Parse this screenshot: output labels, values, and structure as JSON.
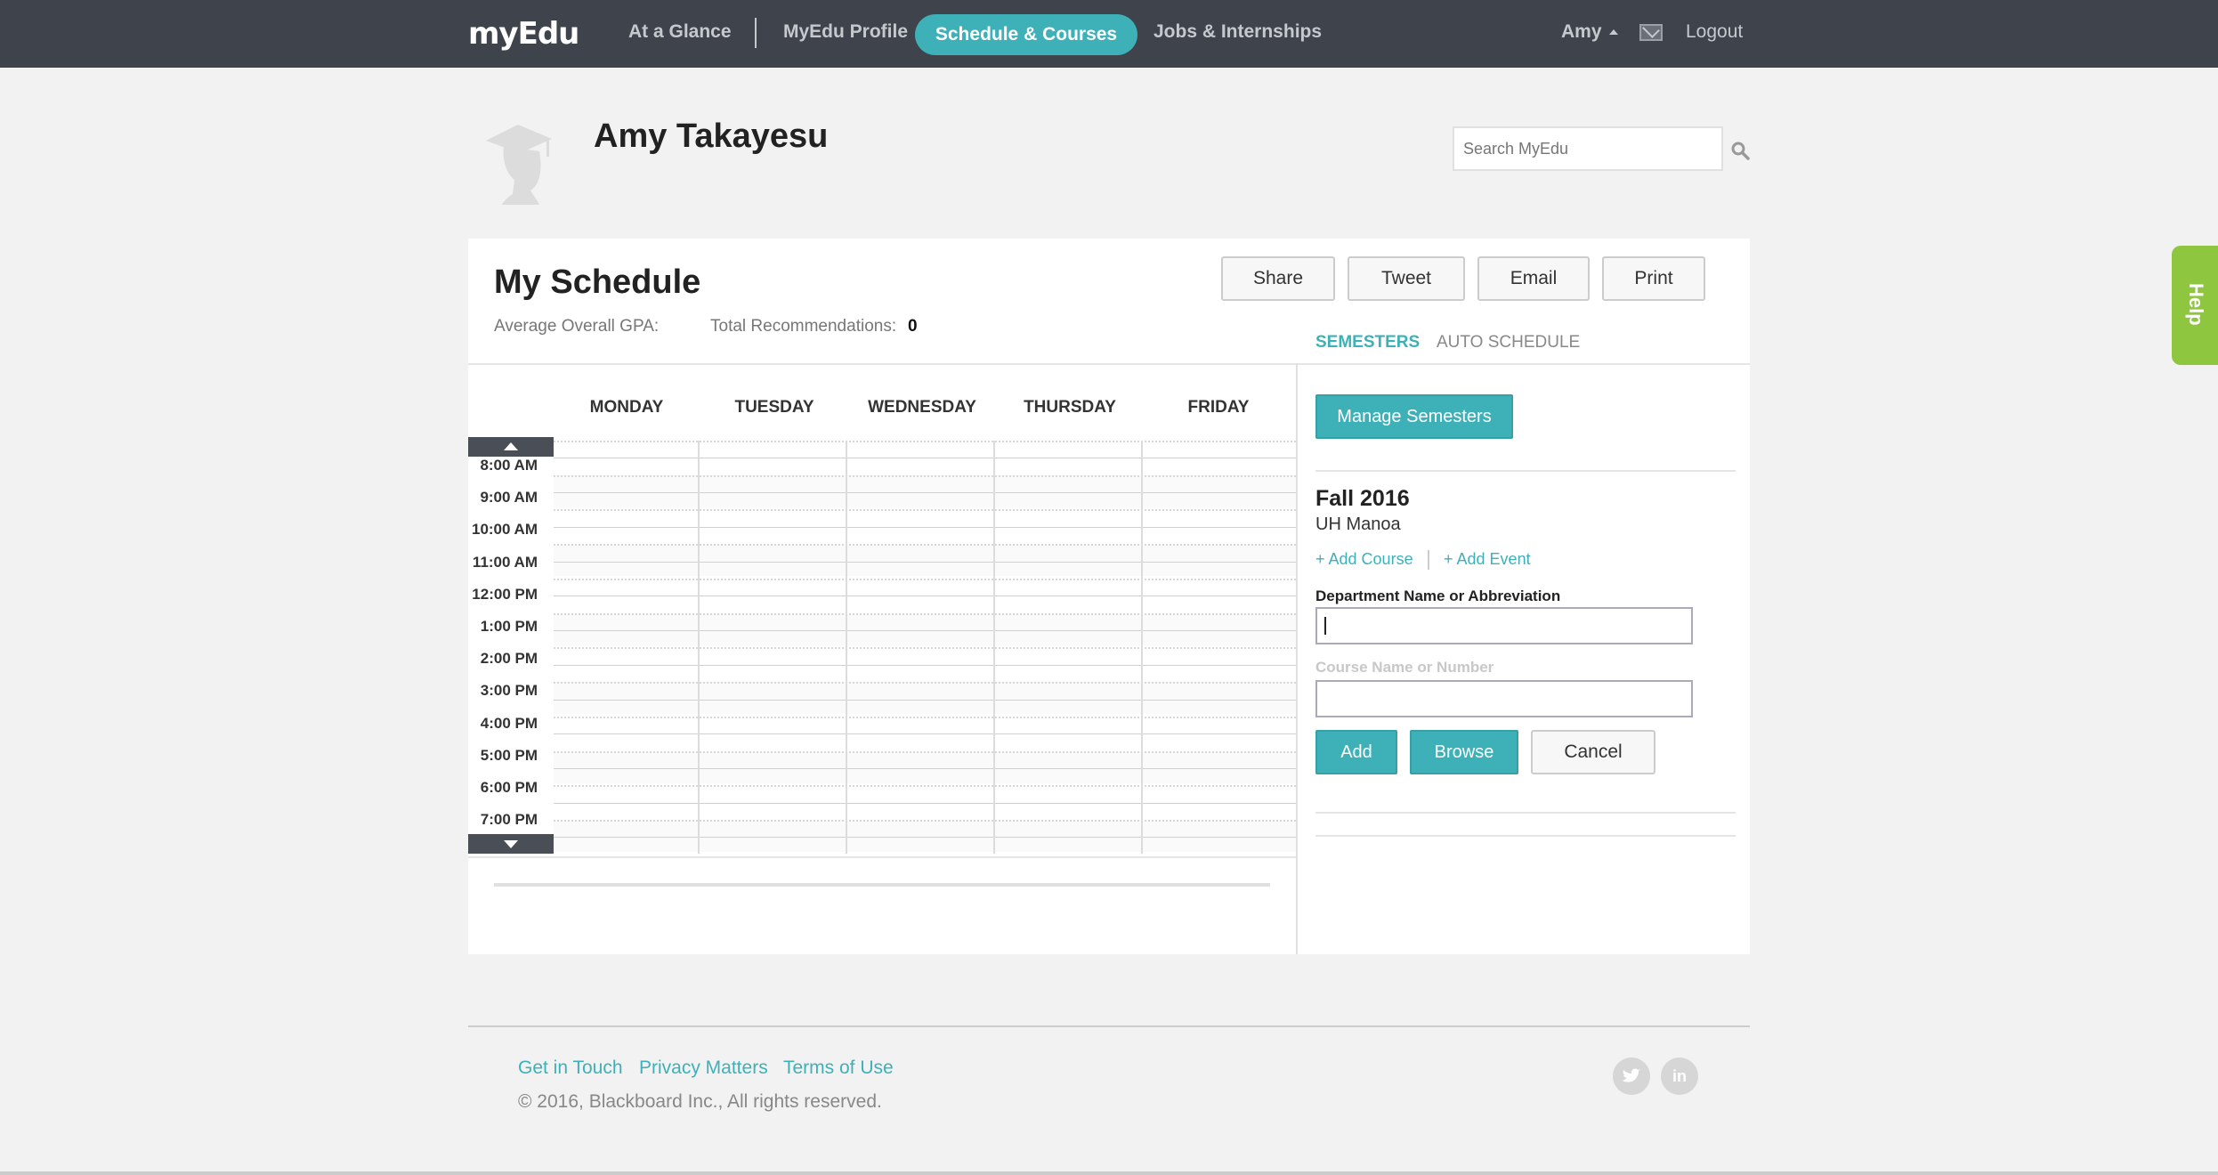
{
  "nav": {
    "logo": "myEdu",
    "links": [
      "At a Glance",
      "MyEdu Profile",
      "Schedule & Courses",
      "Jobs & Internships"
    ],
    "active": "Schedule & Courses",
    "user": "Amy",
    "logout": "Logout",
    "icons": {
      "mail": "mail-icon",
      "caret": "caret-up-icon"
    }
  },
  "profile": {
    "name": "Amy Takayesu",
    "avatar_icon": "graduate-silhouette-icon"
  },
  "search": {
    "placeholder": "Search MyEdu",
    "value": ""
  },
  "help": {
    "label": "Help",
    "color": "#8ec63f"
  },
  "schedule": {
    "title": "My Schedule",
    "gpa_label": "Average Overall GPA:",
    "rec_label": "Total Recommendations:",
    "rec_value": "0",
    "actions": [
      "Share",
      "Tweet",
      "Email",
      "Print"
    ],
    "days": [
      "MONDAY",
      "TUESDAY",
      "WEDNESDAY",
      "THURSDAY",
      "FRIDAY"
    ],
    "times": [
      "8:00 AM",
      "9:00 AM",
      "10:00 AM",
      "11:00 AM",
      "12:00 PM",
      "1:00 PM",
      "2:00 PM",
      "3:00 PM",
      "4:00 PM",
      "5:00 PM",
      "6:00 PM",
      "7:00 PM"
    ]
  },
  "panel": {
    "tabs": [
      "SEMESTERS",
      "AUTO SCHEDULE"
    ],
    "active_tab": "SEMESTERS",
    "manage_button": "Manage Semesters",
    "term": "Fall 2016",
    "school": "UH Manoa",
    "add_course": "+ Add Course",
    "add_event": "+ Add Event",
    "dept_label": "Department Name or Abbreviation",
    "dept_value": "",
    "course_label": "Course Name or Number",
    "course_value": "",
    "add_button": "Add",
    "browse_button": "Browse",
    "cancel_button": "Cancel"
  },
  "footer": {
    "links": [
      "Get in Touch",
      "Privacy Matters",
      "Terms of Use"
    ],
    "copyright": "© 2016, Blackboard Inc., All rights reserved.",
    "social": {
      "twitter": "twitter-icon",
      "linkedin": "linkedin-icon",
      "linkedin_text": "in"
    }
  },
  "colors": {
    "nav_bg": "#3f444c",
    "accent": "#3eb1b8",
    "help": "#8ec63f"
  }
}
